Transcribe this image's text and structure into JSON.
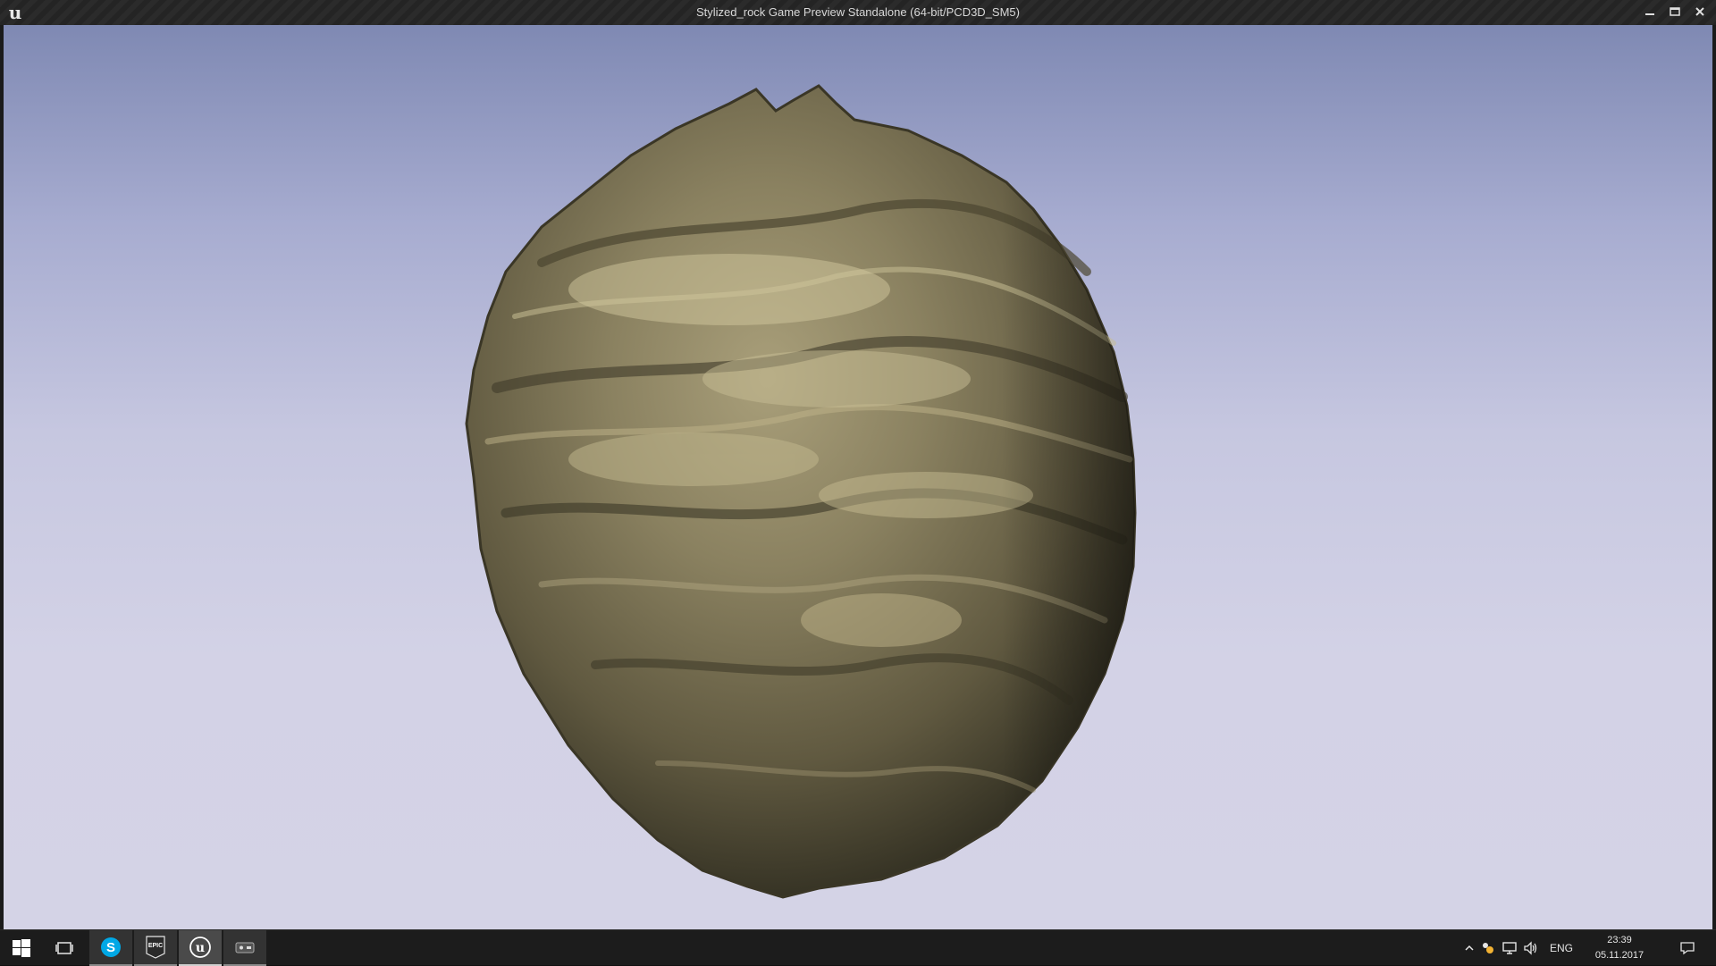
{
  "window": {
    "title": "Stylized_rock Game Preview Standalone (64-bit/PCD3D_SM5)",
    "logo_letter": "u",
    "controls": [
      "minimize-icon",
      "maximize-icon",
      "close-icon"
    ]
  },
  "viewport": {
    "subject": "rock-sphere",
    "background_top": "#7f89b3",
    "background_bottom": "#d4d3e6"
  },
  "taskbar": {
    "apps": [
      {
        "name": "start",
        "icon": "windows-logo-icon"
      },
      {
        "name": "task-view",
        "icon": "task-view-icon"
      },
      {
        "name": "skype",
        "icon": "skype-icon",
        "label": "S"
      },
      {
        "name": "epic-games-launcher",
        "icon": "epic-games-icon",
        "label": "EPIC"
      },
      {
        "name": "unreal-engine",
        "icon": "unreal-engine-icon",
        "label": "u"
      },
      {
        "name": "game-preview",
        "icon": "game-preview-icon"
      }
    ],
    "tray": {
      "language": "ENG",
      "time": "23:39",
      "date": "05.11.2017"
    }
  }
}
